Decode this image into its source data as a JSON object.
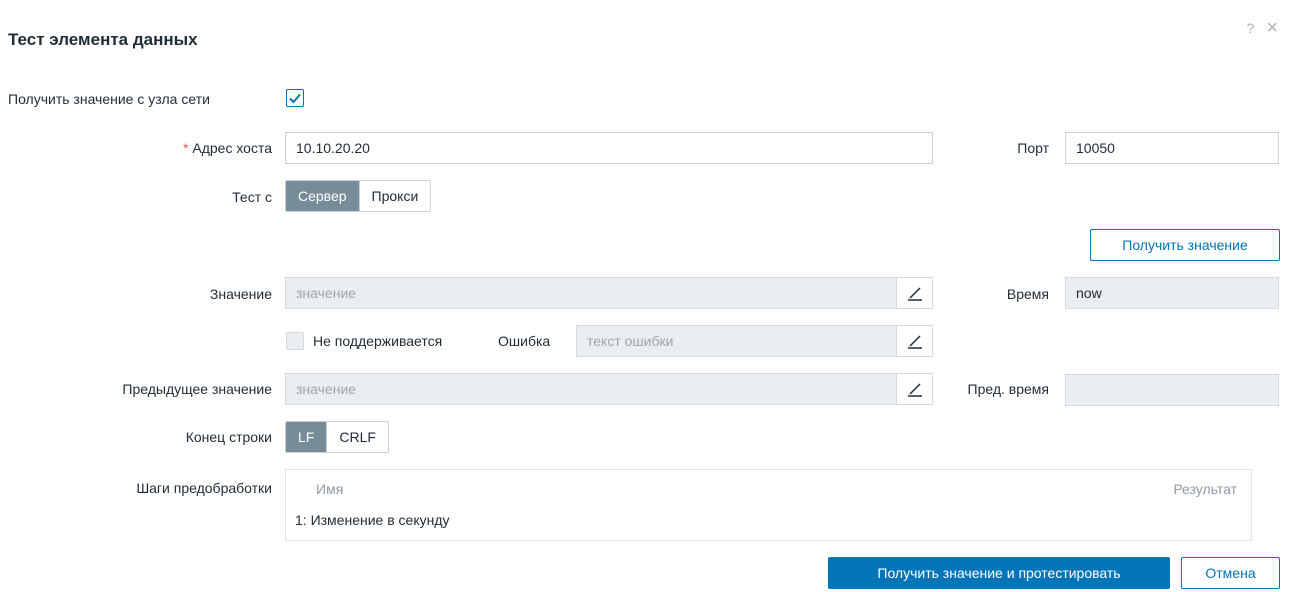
{
  "dialog": {
    "title": "Тест элемента данных",
    "help_icon": "?",
    "close_icon": "×"
  },
  "get_from_host": {
    "label": "Получить значение с узла сети",
    "checked": true
  },
  "host_address": {
    "label": "Адрес хоста",
    "required_mark": "*",
    "value": "10.10.20.20"
  },
  "port": {
    "label": "Порт",
    "value": "10050"
  },
  "test_with": {
    "label": "Тест с",
    "options": [
      "Сервер",
      "Прокси"
    ],
    "selected": "Сервер"
  },
  "get_value_button": "Получить значение",
  "value": {
    "label": "Значение",
    "placeholder": "значение"
  },
  "time": {
    "label": "Время",
    "value": "now"
  },
  "unsupported": {
    "label": "Не поддерживается",
    "checked": false
  },
  "error": {
    "label": "Ошибка",
    "placeholder": "текст ошибки"
  },
  "prev_value": {
    "label": "Предыдущее значение",
    "placeholder": "значение"
  },
  "prev_time": {
    "label": "Пред. время",
    "value": ""
  },
  "eol": {
    "label": "Конец строки",
    "options": [
      "LF",
      "CRLF"
    ],
    "selected": "LF"
  },
  "preprocessing": {
    "label": "Шаги предобработки",
    "columns": [
      "Имя",
      "Результат"
    ],
    "rows": [
      {
        "name": "1: Изменение в секунду",
        "result": ""
      }
    ]
  },
  "footer": {
    "primary_button": "Получить значение и протестировать",
    "cancel_button": "Отмена"
  },
  "colors": {
    "accent": "#0275b8",
    "segment_active": "#768d99",
    "required": "#e45959",
    "readonly_bg": "#ebeef0"
  },
  "icons": [
    "help-icon",
    "close-icon",
    "checkmark-icon",
    "pencil-icon"
  ]
}
